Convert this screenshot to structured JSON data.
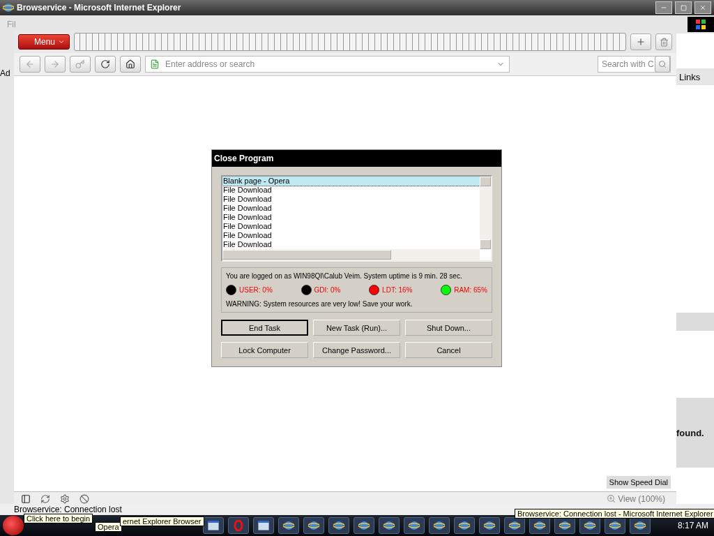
{
  "ie_window": {
    "title": "Browservice - Microsoft Internet Explorer",
    "menu_fragment": "Fil",
    "address_fragment": "Ad",
    "links": "Links",
    "content_fragment": "found.",
    "status": "Browservice: Connection lost"
  },
  "opera": {
    "menu_button": "Menu",
    "address": {
      "placeholder": "Enter address or search"
    },
    "search": {
      "placeholder": "Search with C"
    },
    "speed_dial_button": "Show Speed Dial",
    "zoom": "View (100%)"
  },
  "dialog": {
    "title": "Close Program",
    "tasks": [
      {
        "name": "Blank page - Opera",
        "selected": true
      },
      {
        "name": "File Download",
        "selected": false
      },
      {
        "name": "File Download",
        "selected": false
      },
      {
        "name": "File Download",
        "selected": false
      },
      {
        "name": "File Download",
        "selected": false
      },
      {
        "name": "File Download",
        "selected": false
      },
      {
        "name": "File Download",
        "selected": false
      },
      {
        "name": "File Download",
        "selected": false
      }
    ],
    "logon": "You are logged on as WIN98QI\\Calub Veim. System uptime is 9 min. 28 sec.",
    "resources": [
      {
        "label": "USER: 0%",
        "color": "#000000"
      },
      {
        "label": "GDI: 0%",
        "color": "#000000"
      },
      {
        "label": "LDT: 16%",
        "color": "#ff0000"
      },
      {
        "label": "RAM: 65%",
        "color": "#00ff00"
      }
    ],
    "warning": "WARNING: System resources are very low! Save your work.",
    "buttons": [
      {
        "label": "End Task",
        "default": true
      },
      {
        "label": "New Task (Run)...",
        "default": false
      },
      {
        "label": "Shut Down...",
        "default": false
      },
      {
        "label": "Lock Computer",
        "default": false
      },
      {
        "label": "Change Password...",
        "default": false
      },
      {
        "label": "Cancel",
        "default": false
      }
    ]
  },
  "taskbar": {
    "start_tooltip": "Click here to begin",
    "opera_tooltip": "Opera",
    "ie_tooltip": "ernet Explorer Browser",
    "window_tooltip": "Browservice: Connection lost - Microsoft Internet Explorer",
    "clock": "8:17 AM",
    "buttons": [
      {
        "kind": "app"
      },
      {
        "kind": "opera"
      },
      {
        "kind": "app"
      },
      {
        "kind": "ie"
      },
      {
        "kind": "ie"
      },
      {
        "kind": "ie"
      },
      {
        "kind": "ie"
      },
      {
        "kind": "ie"
      },
      {
        "kind": "ie"
      },
      {
        "kind": "ie"
      },
      {
        "kind": "ie"
      },
      {
        "kind": "ie"
      },
      {
        "kind": "ie"
      },
      {
        "kind": "ie"
      },
      {
        "kind": "ie"
      },
      {
        "kind": "ie"
      },
      {
        "kind": "ie"
      },
      {
        "kind": "ie"
      }
    ]
  }
}
